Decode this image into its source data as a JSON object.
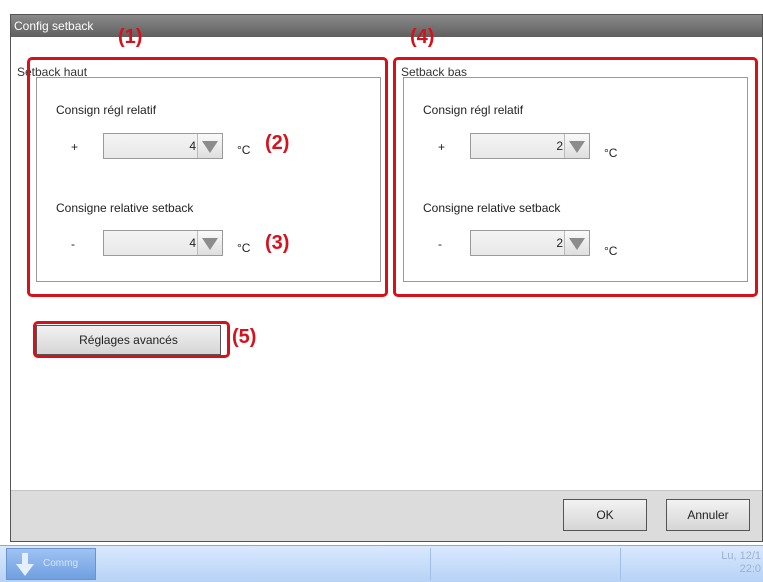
{
  "window": {
    "title": "Config setback"
  },
  "groups": {
    "haut": {
      "label": "Setback haut",
      "relatif_label": "Consign régl relatif",
      "relatif_sign": "+",
      "relatif_value": "4",
      "setback_label": "Consigne relative setback",
      "setback_sign": "-",
      "setback_value": "4",
      "unit": "°C"
    },
    "bas": {
      "label": "Setback bas",
      "relatif_label": "Consign régl relatif",
      "relatif_sign": "+",
      "relatif_value": "2",
      "setback_label": "Consigne relative setback",
      "setback_sign": "-",
      "setback_value": "2",
      "unit": "°C"
    }
  },
  "buttons": {
    "advanced": "Réglages avancés",
    "ok": "OK",
    "cancel": "Annuler"
  },
  "callouts": {
    "c1": "(1)",
    "c2": "(2)",
    "c3": "(3)",
    "c4": "(4)",
    "c5": "(5)"
  },
  "taskbar": {
    "task_label": "Commg",
    "clock_line1": "Lu, 12/1",
    "clock_line2": "22:0"
  },
  "colors": {
    "callout_red": "#d7111c",
    "titlebar": "#6e6e6e",
    "taskbar": "#b7d2f5"
  },
  "icons": [
    "down-arrow-icon",
    "spinner-arrow-icon"
  ]
}
